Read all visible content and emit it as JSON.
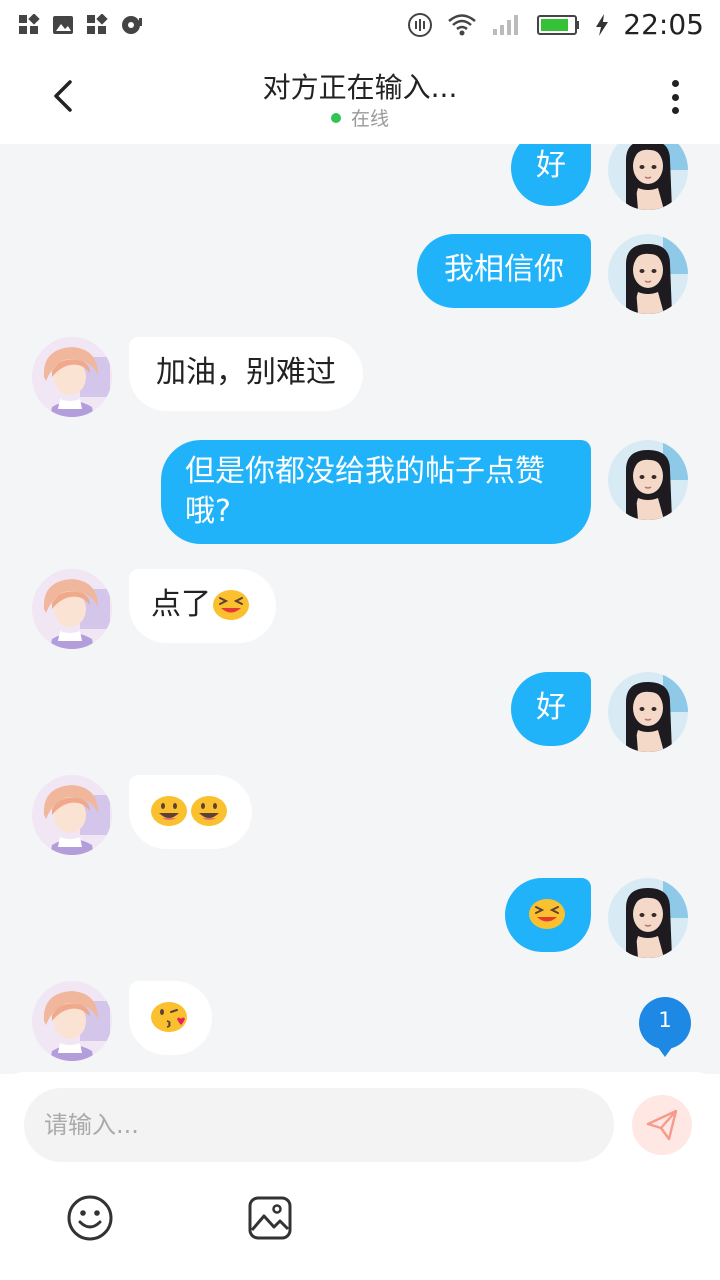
{
  "status_bar": {
    "time": "22:05"
  },
  "header": {
    "title": "对方正在输入...",
    "status": "在线",
    "back_icon": "chevron-left-icon",
    "more_icon": "more-vertical-icon"
  },
  "colors": {
    "my_bubble": "#21b3f9",
    "other_bubble": "#ffffff",
    "chat_bg": "#f4f5f7",
    "online": "#2ec653"
  },
  "messages": [
    {
      "from": "me",
      "text": "好"
    },
    {
      "from": "me",
      "text": "我相信你"
    },
    {
      "from": "other",
      "text": "加油，别难过"
    },
    {
      "from": "me",
      "text": "但是你都没给我的帖子点赞哦?"
    },
    {
      "from": "other",
      "text": "点了",
      "emoji": "grinning-squint-emoji"
    },
    {
      "from": "me",
      "text": "好"
    },
    {
      "from": "other",
      "emoji": "smiley-emoji x2"
    },
    {
      "from": "me",
      "emoji": "grinning-squint-emoji"
    },
    {
      "from": "other",
      "emoji": "kissing-heart-emoji"
    }
  ],
  "unread_count": "1",
  "input": {
    "placeholder": "请输入..."
  },
  "toolbar": {
    "send_icon": "send-icon",
    "emoji_icon": "smiley-icon",
    "image_icon": "image-icon"
  }
}
